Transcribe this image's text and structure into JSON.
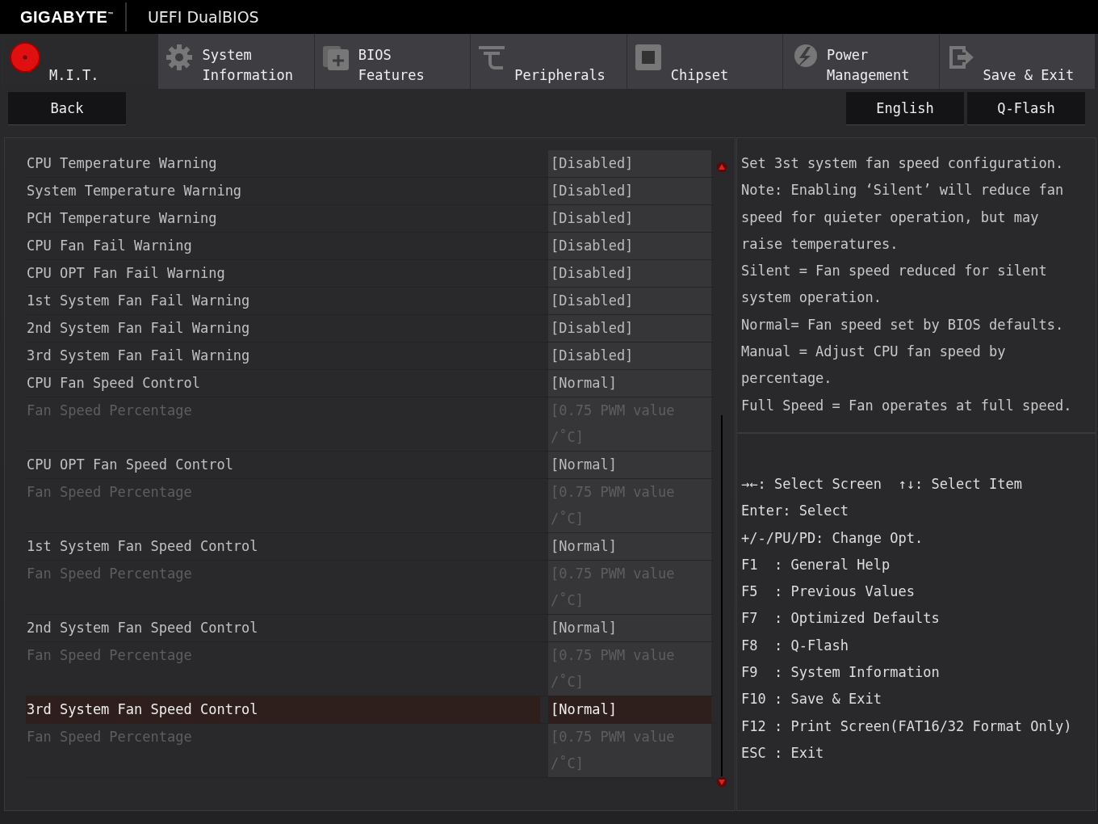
{
  "header": {
    "logo": "GIGABYTE$^{™}$",
    "title": "UEFI DualBIOS"
  },
  "tabs": [
    {
      "label": "M.I.T.",
      "selected": true
    },
    {
      "label": "System Information",
      "selected": false
    },
    {
      "label": "BIOS Features",
      "selected": false
    },
    {
      "label": "Peripherals",
      "selected": false
    },
    {
      "label": "Chipset",
      "selected": false
    },
    {
      "label": "Power Management",
      "selected": false
    },
    {
      "label": "Save & Exit",
      "selected": false
    }
  ],
  "left_buttons": [
    "Back"
  ],
  "right_buttons": [
    "English",
    "Q-Flash"
  ],
  "settings": [
    {
      "label": "CPU Temperature Warning",
      "value": "[Disabled]",
      "disabled": false,
      "selected": false
    },
    {
      "label": "System Temperature Warning",
      "value": "[Disabled]",
      "disabled": false,
      "selected": false
    },
    {
      "label": "PCH Temperature Warning",
      "value": "[Disabled]",
      "disabled": false,
      "selected": false
    },
    {
      "label": "CPU Fan Fail Warning",
      "value": "[Disabled]",
      "disabled": false,
      "selected": false
    },
    {
      "label": "CPU OPT Fan Fail Warning",
      "value": "[Disabled]",
      "disabled": false,
      "selected": false
    },
    {
      "label": "1st System Fan Fail Warning",
      "value": "[Disabled]",
      "disabled": false,
      "selected": false
    },
    {
      "label": "2nd System Fan Fail Warning",
      "value": "[Disabled]",
      "disabled": false,
      "selected": false
    },
    {
      "label": "3rd System Fan Fail Warning",
      "value": "[Disabled]",
      "disabled": false,
      "selected": false
    },
    {
      "label": "CPU Fan Speed Control",
      "value": "[Normal]",
      "disabled": false,
      "selected": false
    },
    {
      "label": "Fan Speed Percentage",
      "value": "[0.75 PWM value /˚C]",
      "disabled": true,
      "selected": false
    },
    {
      "label": "CPU OPT Fan Speed Control",
      "value": "[Normal]",
      "disabled": false,
      "selected": false
    },
    {
      "label": "Fan Speed Percentage",
      "value": "[0.75 PWM value /˚C]",
      "disabled": true,
      "selected": false
    },
    {
      "label": "1st System Fan Speed Control",
      "value": "[Normal]",
      "disabled": false,
      "selected": false
    },
    {
      "label": "Fan Speed Percentage",
      "value": "[0.75 PWM value /˚C]",
      "disabled": true,
      "selected": false
    },
    {
      "label": "2nd System Fan Speed Control",
      "value": "[Normal]",
      "disabled": false,
      "selected": false
    },
    {
      "label": "Fan Speed Percentage",
      "value": "[0.75 PWM value /˚C]",
      "disabled": true,
      "selected": false
    },
    {
      "label": "3rd System Fan Speed Control",
      "value": "[Normal]",
      "disabled": false,
      "selected": true
    },
    {
      "label": "Fan Speed Percentage",
      "value": "[0.75 PWM value /˚C]",
      "disabled": true,
      "selected": false
    }
  ],
  "help": {
    "description": [
      "Set 3st system fan speed configuration.",
      "Note: Enabling ‘Silent’ will reduce fan speed for quieter operation, but may raise temperatures.",
      "Silent = Fan speed reduced for silent system operation.",
      "Normal= Fan speed set by BIOS defaults.",
      "Manual = Adjust CPU fan speed by percentage.",
      "Full Speed = Fan operates at full speed."
    ],
    "keys": [
      "→←: Select Screen  ↑↓: Select Item",
      "Enter: Select",
      "+/-/PU/PD: Change Opt.",
      "F1  : General Help",
      "F5  : Previous Values",
      "F7  : Optimized Defaults",
      "F8  : Q-Flash",
      "F9  : System Information",
      "F10 : Save & Exit",
      "F12 : Print Screen(FAT16/32 Format Only)",
      "ESC : Exit"
    ]
  }
}
